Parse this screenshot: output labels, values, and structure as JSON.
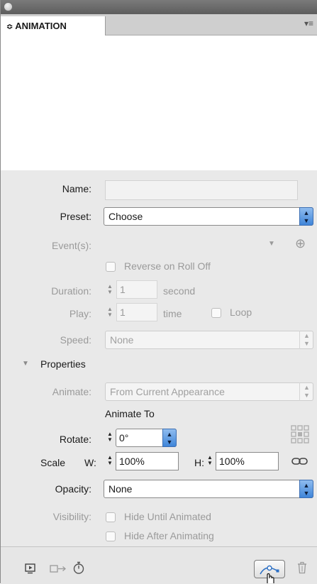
{
  "panel": {
    "tab_label": "ANIMATION",
    "tab_arrows": "≎",
    "menu_glyph": "▾≡"
  },
  "form": {
    "name_label": "Name:",
    "name_value": "",
    "preset_label": "Preset:",
    "preset_value": "Choose",
    "events_label": "Event(s):",
    "reverse_label": "Reverse on Roll Off",
    "duration_label": "Duration:",
    "duration_value": "1",
    "duration_unit": "second",
    "play_label": "Play:",
    "play_value": "1",
    "play_unit": "time",
    "loop_label": "Loop",
    "speed_label": "Speed:",
    "speed_value": "None"
  },
  "properties": {
    "header": "Properties",
    "animate_label": "Animate:",
    "animate_value": "From Current Appearance",
    "animate_to": "Animate To",
    "rotate_label": "Rotate:",
    "rotate_value": "0°",
    "scale_label": "Scale",
    "w_label": "W:",
    "w_value": "100%",
    "h_label": "H:",
    "h_value": "100%",
    "opacity_label": "Opacity:",
    "opacity_value": "None",
    "visibility_label": "Visibility:",
    "hide_until_label": "Hide Until Animated",
    "hide_after_label": "Hide After Animating"
  },
  "icons": {
    "preview": "preview-icon",
    "convert": "convert-to-motion-path-icon",
    "timing": "timing-icon",
    "path": "edit-path-icon",
    "trash": "trash-icon"
  },
  "colors": {
    "accent": "#3f85d9",
    "panel_bg": "#e9e9e9"
  }
}
